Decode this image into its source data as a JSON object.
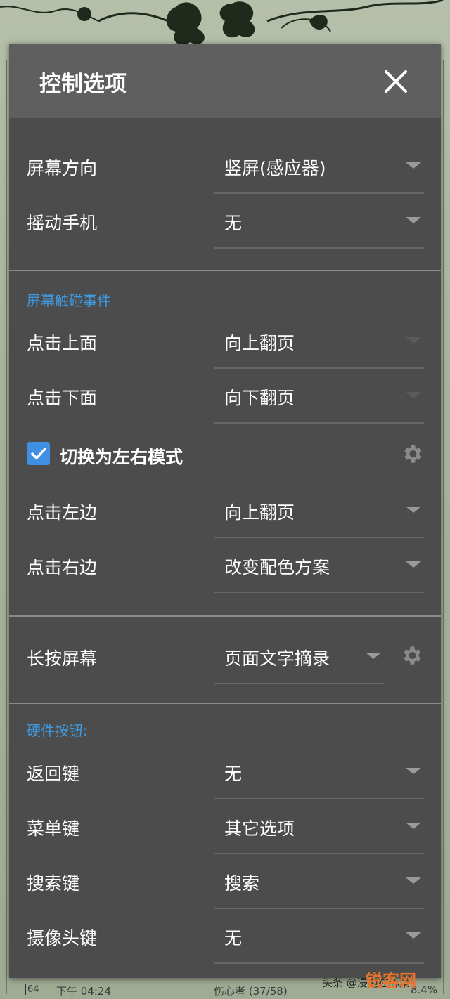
{
  "dialog": {
    "title": "控制选项",
    "close_icon": "close-icon"
  },
  "screen": {
    "orientation": {
      "label": "屏幕方向",
      "value": "竖屏(感应器)"
    },
    "shake": {
      "label": "摇动手机",
      "value": "无"
    }
  },
  "touch": {
    "header": "屏幕触碰事件",
    "tap_top": {
      "label": "点击上面",
      "value": "向上翻页"
    },
    "tap_bottom": {
      "label": "点击下面",
      "value": "向下翻页"
    },
    "lr_mode": {
      "label": "切换为左右模式",
      "checked": true,
      "icon": "gear-icon"
    },
    "tap_left": {
      "label": "点击左边",
      "value": "向上翻页"
    },
    "tap_right": {
      "label": "点击右边",
      "value": "改变配色方案"
    }
  },
  "long_press": {
    "label": "长按屏幕",
    "value": "页面文字摘录",
    "icon": "gear-icon"
  },
  "hardware": {
    "header": "硬件按钮:",
    "back": {
      "label": "返回键",
      "value": "无"
    },
    "menu": {
      "label": "菜单键",
      "value": "其它选项"
    },
    "search": {
      "label": "搜索键",
      "value": "搜索"
    },
    "camera": {
      "label": "摄像头键",
      "value": "无"
    }
  },
  "status_bar": {
    "battery": "64",
    "time": "下午 04:24",
    "book": "伤心者 (37/58)",
    "progress": "8.4%"
  },
  "watermark": {
    "left": "头条 @浸泡在心菜",
    "right": "锐客网"
  },
  "colors": {
    "dialog_bg": "#4c4c4c",
    "header_bg": "#5f5f5f",
    "accent": "#3e9ae0",
    "checkbox": "#3f8fe2"
  }
}
